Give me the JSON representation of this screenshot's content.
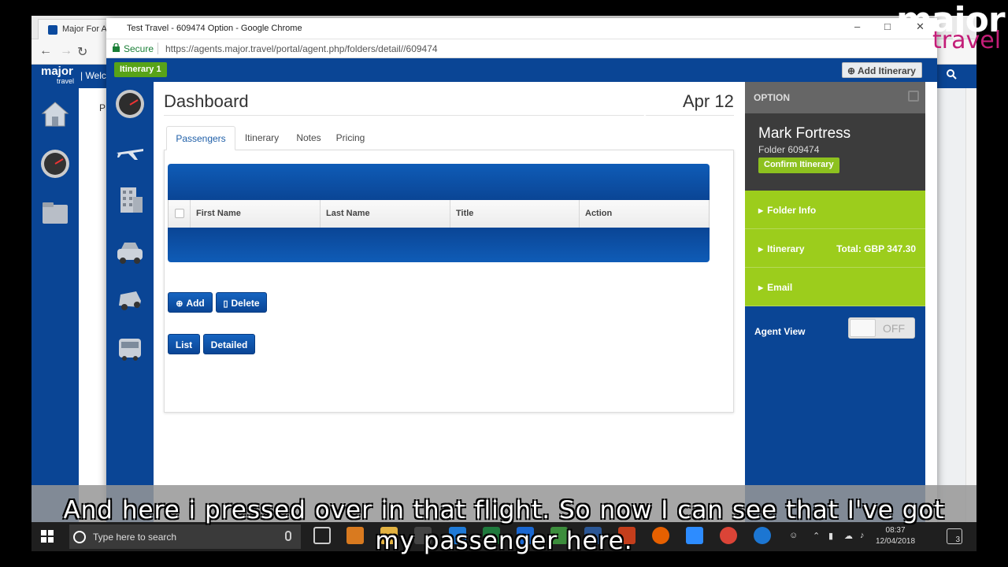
{
  "background_window": {
    "tab_title": "Major For A",
    "header_welcome": "| Welc",
    "logo": "major",
    "logo_sub": "travel",
    "left_text": "P"
  },
  "popup": {
    "title": "Test Travel - 609474 Option - Google Chrome",
    "secure_label": "Secure",
    "url": "https://agents.major.travel/portal/agent.php/folders/detail//609474",
    "itinerary_badge": "Itinerary 1",
    "add_itinerary": "Add Itinerary"
  },
  "dashboard": {
    "title": "Dashboard",
    "date": "Apr 12",
    "tabs": [
      {
        "label": "Passengers"
      },
      {
        "label": "Itinerary"
      },
      {
        "label": "Notes"
      },
      {
        "label": "Pricing"
      }
    ],
    "table_columns": [
      "First Name",
      "Last Name",
      "Title",
      "Action"
    ],
    "buttons": {
      "add": "Add",
      "delete": "Delete",
      "list": "List",
      "detailed": "Detailed"
    }
  },
  "side_panel": {
    "header": "OPTION",
    "name": "Mark Fortress",
    "folder": "Folder 609474",
    "confirm": "Confirm Itinerary",
    "rows": [
      {
        "label": "Folder Info",
        "value": ""
      },
      {
        "label": "Itinerary",
        "value": "Total: GBP 347.30"
      },
      {
        "label": "Email",
        "value": ""
      }
    ],
    "agent_view_label": "Agent View",
    "agent_view_state": "OFF"
  },
  "taskbar": {
    "search_placeholder": "Type here to search",
    "time": "08:37",
    "date": "12/04/2018",
    "notifications": "3"
  },
  "overlay": {
    "watermark_major": "major",
    "watermark_travel": "travel",
    "subtitle_line1": "And here i pressed over in that flight. So now I can see that I've got",
    "subtitle_line2": "my passenger here."
  },
  "colors": {
    "brand_blue": "#0a4595",
    "accent_green": "#9ccd1c",
    "badge_green": "#58a318",
    "brand_magenta": "#c31e78"
  }
}
